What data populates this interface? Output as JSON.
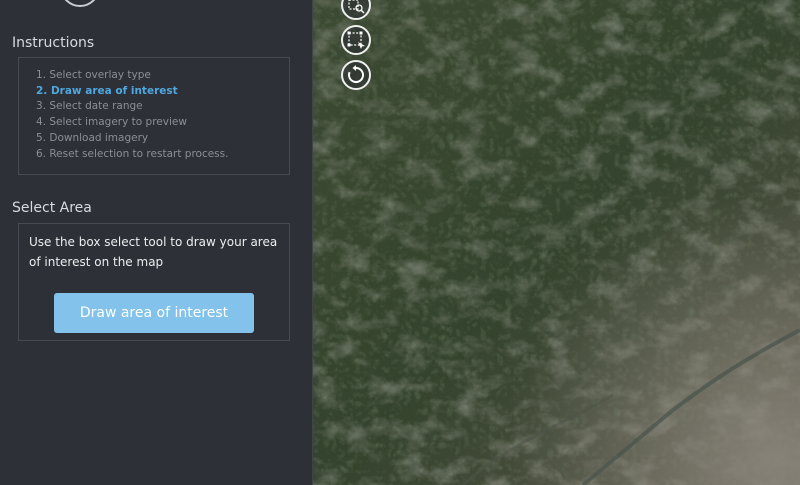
{
  "sidebar": {
    "instructions_title": "Instructions",
    "steps": [
      "1. Select overlay type",
      "2. Draw area of interest",
      "3. Select date range",
      "4. Select imagery to preview",
      "5. Download imagery",
      "6. Reset selection to restart process."
    ],
    "active_step_index": 1,
    "select_area_title": "Select Area",
    "select_area_text": "Use the box select tool to draw your area of interest on the map",
    "draw_button_label": "Draw area of interest"
  },
  "map_tools": [
    {
      "name": "zoom-select-icon"
    },
    {
      "name": "box-select-icon"
    },
    {
      "name": "reset-icon"
    }
  ],
  "colors": {
    "accent": "#4ea7e0",
    "button": "#82c2eb",
    "sidebar_bg": "#2d3137"
  }
}
